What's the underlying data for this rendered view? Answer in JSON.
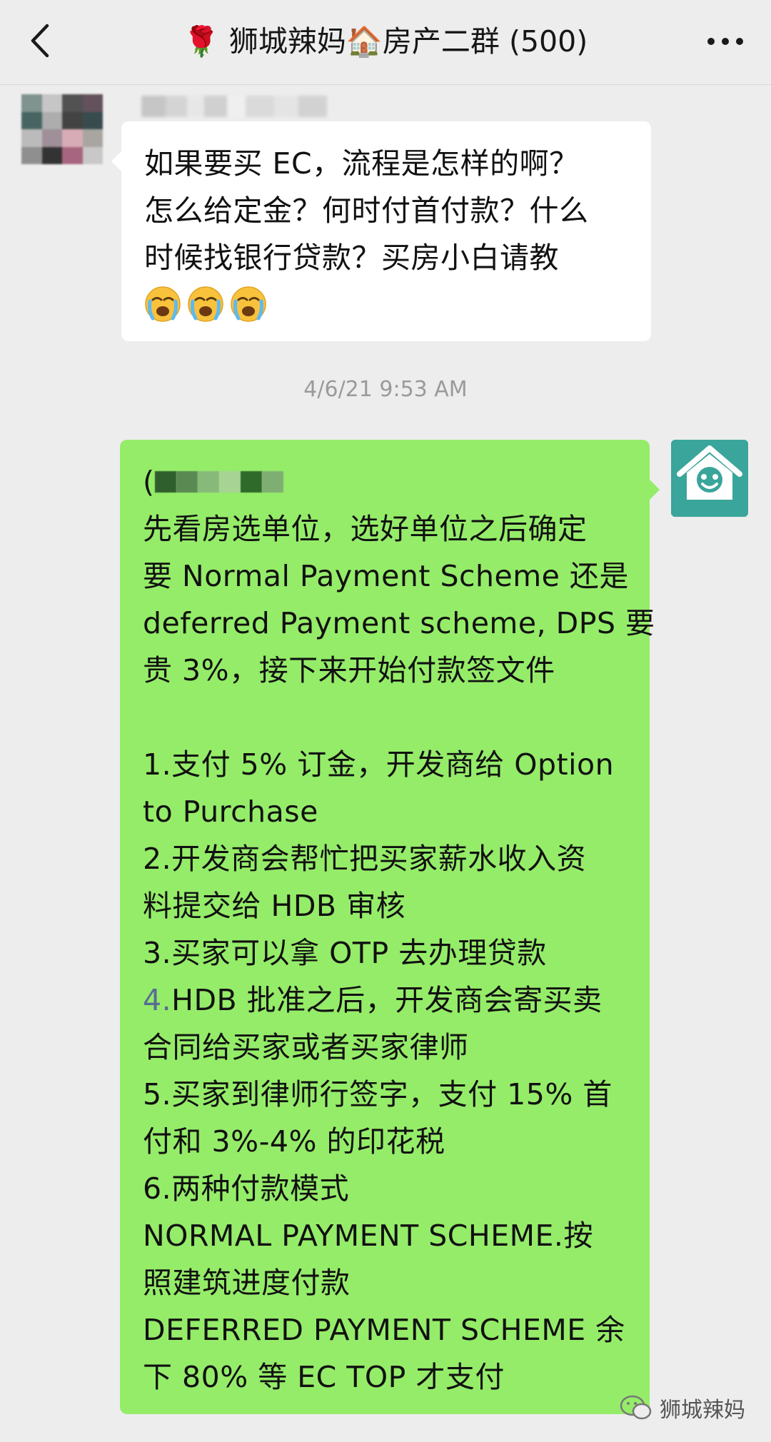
{
  "header": {
    "title": "🌹 狮城辣妈🏠房产二群 (500)",
    "back_icon": "chevron-left-icon",
    "more_icon": "more-dots-icon"
  },
  "incoming_message": {
    "lines": [
      "如果要买 EC，流程是怎样的啊？",
      "怎么给定金？何时付首付款？什么",
      "时候找银行贷款？买房小白请教"
    ],
    "emojis": [
      "😭",
      "😭",
      "😭"
    ]
  },
  "timestamp": "4/6/21 9:53 AM",
  "outgoing_message": {
    "prefix": "(",
    "lines": [
      "先看房选单位，选好单位之后确定",
      "要 Normal Payment Scheme 还是",
      "deferred Payment scheme, DPS 要",
      "贵 3%，接下来开始付款签文件",
      "",
      "1.支付 5% 订金，开发商给 Option",
      "to Purchase",
      "2.开发商会帮忙把买家薪水收入资",
      "料提交给 HDB 审核",
      "3.买家可以拿 OTP 去办理贷款",
      "HDB 批准之后，开发商会寄买卖",
      "合同给买家或者买家律师",
      "5.买家到律师行签字，支付 15% 首",
      "付和 3%-4% 的印花税",
      "6.两种付款模式",
      "NORMAL PAYMENT SCHEME.按",
      "照建筑进度付款",
      "DEFERRED PAYMENT SCHEME 余",
      "下 80% 等 EC TOP 才支付"
    ],
    "link_prefix": "4."
  },
  "watermark": {
    "text": "狮城辣妈",
    "icon": "wechat-icon"
  },
  "colors": {
    "background": "#ededed",
    "incoming_bubble": "#ffffff",
    "outgoing_bubble": "#95ec69",
    "avatar_right": "#3aa59a",
    "link": "#586c94"
  }
}
